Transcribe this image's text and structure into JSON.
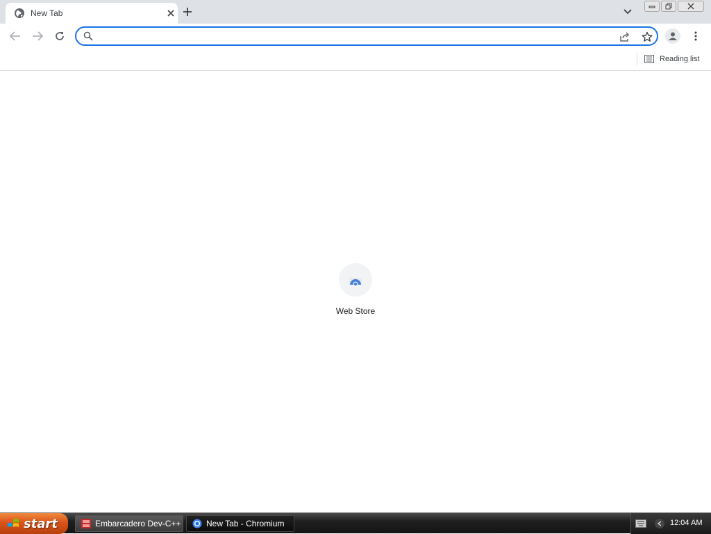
{
  "tab": {
    "title": "New Tab"
  },
  "omnibox": {
    "value": "",
    "placeholder": ""
  },
  "bookmarks": {
    "reading_list": "Reading list"
  },
  "content": {
    "shortcuts": [
      {
        "label": "Web Store"
      }
    ]
  },
  "taskbar": {
    "start_label": "start",
    "items": [
      {
        "label": "Embarcadero Dev-C++"
      },
      {
        "label": "New Tab - Chromium"
      }
    ],
    "clock": "12:04 AM"
  },
  "colors": {
    "accent": "#1a73e8",
    "tabstrip": "#dee1e6",
    "start": "#d8541a"
  }
}
